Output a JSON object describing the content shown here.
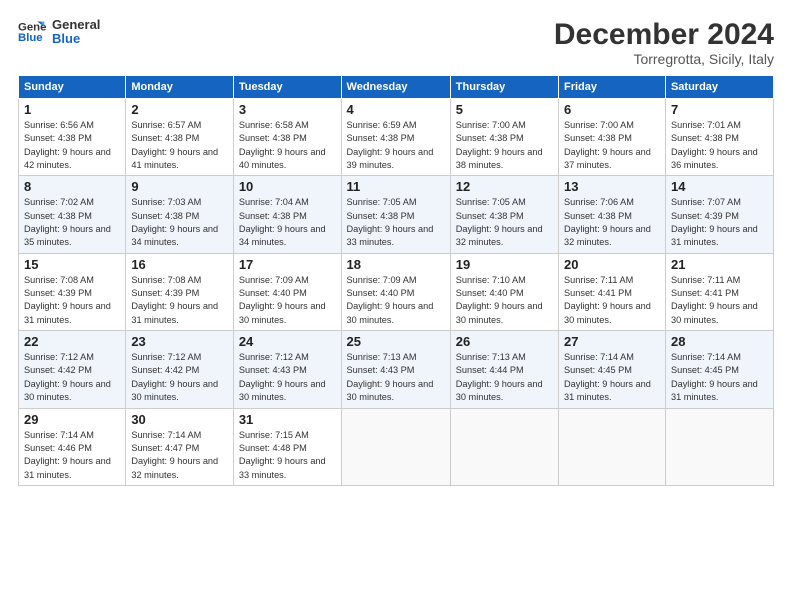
{
  "logo": {
    "line1": "General",
    "line2": "Blue"
  },
  "title": "December 2024",
  "location": "Torregrotta, Sicily, Italy",
  "headers": [
    "Sunday",
    "Monday",
    "Tuesday",
    "Wednesday",
    "Thursday",
    "Friday",
    "Saturday"
  ],
  "weeks": [
    [
      {
        "day": "1",
        "sunrise": "6:56 AM",
        "sunset": "4:38 PM",
        "daylight": "9 hours and 42 minutes."
      },
      {
        "day": "2",
        "sunrise": "6:57 AM",
        "sunset": "4:38 PM",
        "daylight": "9 hours and 41 minutes."
      },
      {
        "day": "3",
        "sunrise": "6:58 AM",
        "sunset": "4:38 PM",
        "daylight": "9 hours and 40 minutes."
      },
      {
        "day": "4",
        "sunrise": "6:59 AM",
        "sunset": "4:38 PM",
        "daylight": "9 hours and 39 minutes."
      },
      {
        "day": "5",
        "sunrise": "7:00 AM",
        "sunset": "4:38 PM",
        "daylight": "9 hours and 38 minutes."
      },
      {
        "day": "6",
        "sunrise": "7:00 AM",
        "sunset": "4:38 PM",
        "daylight": "9 hours and 37 minutes."
      },
      {
        "day": "7",
        "sunrise": "7:01 AM",
        "sunset": "4:38 PM",
        "daylight": "9 hours and 36 minutes."
      }
    ],
    [
      {
        "day": "8",
        "sunrise": "7:02 AM",
        "sunset": "4:38 PM",
        "daylight": "9 hours and 35 minutes."
      },
      {
        "day": "9",
        "sunrise": "7:03 AM",
        "sunset": "4:38 PM",
        "daylight": "9 hours and 34 minutes."
      },
      {
        "day": "10",
        "sunrise": "7:04 AM",
        "sunset": "4:38 PM",
        "daylight": "9 hours and 34 minutes."
      },
      {
        "day": "11",
        "sunrise": "7:05 AM",
        "sunset": "4:38 PM",
        "daylight": "9 hours and 33 minutes."
      },
      {
        "day": "12",
        "sunrise": "7:05 AM",
        "sunset": "4:38 PM",
        "daylight": "9 hours and 32 minutes."
      },
      {
        "day": "13",
        "sunrise": "7:06 AM",
        "sunset": "4:38 PM",
        "daylight": "9 hours and 32 minutes."
      },
      {
        "day": "14",
        "sunrise": "7:07 AM",
        "sunset": "4:39 PM",
        "daylight": "9 hours and 31 minutes."
      }
    ],
    [
      {
        "day": "15",
        "sunrise": "7:08 AM",
        "sunset": "4:39 PM",
        "daylight": "9 hours and 31 minutes."
      },
      {
        "day": "16",
        "sunrise": "7:08 AM",
        "sunset": "4:39 PM",
        "daylight": "9 hours and 31 minutes."
      },
      {
        "day": "17",
        "sunrise": "7:09 AM",
        "sunset": "4:40 PM",
        "daylight": "9 hours and 30 minutes."
      },
      {
        "day": "18",
        "sunrise": "7:09 AM",
        "sunset": "4:40 PM",
        "daylight": "9 hours and 30 minutes."
      },
      {
        "day": "19",
        "sunrise": "7:10 AM",
        "sunset": "4:40 PM",
        "daylight": "9 hours and 30 minutes."
      },
      {
        "day": "20",
        "sunrise": "7:11 AM",
        "sunset": "4:41 PM",
        "daylight": "9 hours and 30 minutes."
      },
      {
        "day": "21",
        "sunrise": "7:11 AM",
        "sunset": "4:41 PM",
        "daylight": "9 hours and 30 minutes."
      }
    ],
    [
      {
        "day": "22",
        "sunrise": "7:12 AM",
        "sunset": "4:42 PM",
        "daylight": "9 hours and 30 minutes."
      },
      {
        "day": "23",
        "sunrise": "7:12 AM",
        "sunset": "4:42 PM",
        "daylight": "9 hours and 30 minutes."
      },
      {
        "day": "24",
        "sunrise": "7:12 AM",
        "sunset": "4:43 PM",
        "daylight": "9 hours and 30 minutes."
      },
      {
        "day": "25",
        "sunrise": "7:13 AM",
        "sunset": "4:43 PM",
        "daylight": "9 hours and 30 minutes."
      },
      {
        "day": "26",
        "sunrise": "7:13 AM",
        "sunset": "4:44 PM",
        "daylight": "9 hours and 30 minutes."
      },
      {
        "day": "27",
        "sunrise": "7:14 AM",
        "sunset": "4:45 PM",
        "daylight": "9 hours and 31 minutes."
      },
      {
        "day": "28",
        "sunrise": "7:14 AM",
        "sunset": "4:45 PM",
        "daylight": "9 hours and 31 minutes."
      }
    ],
    [
      {
        "day": "29",
        "sunrise": "7:14 AM",
        "sunset": "4:46 PM",
        "daylight": "9 hours and 31 minutes."
      },
      {
        "day": "30",
        "sunrise": "7:14 AM",
        "sunset": "4:47 PM",
        "daylight": "9 hours and 32 minutes."
      },
      {
        "day": "31",
        "sunrise": "7:15 AM",
        "sunset": "4:48 PM",
        "daylight": "9 hours and 33 minutes."
      },
      null,
      null,
      null,
      null
    ]
  ]
}
